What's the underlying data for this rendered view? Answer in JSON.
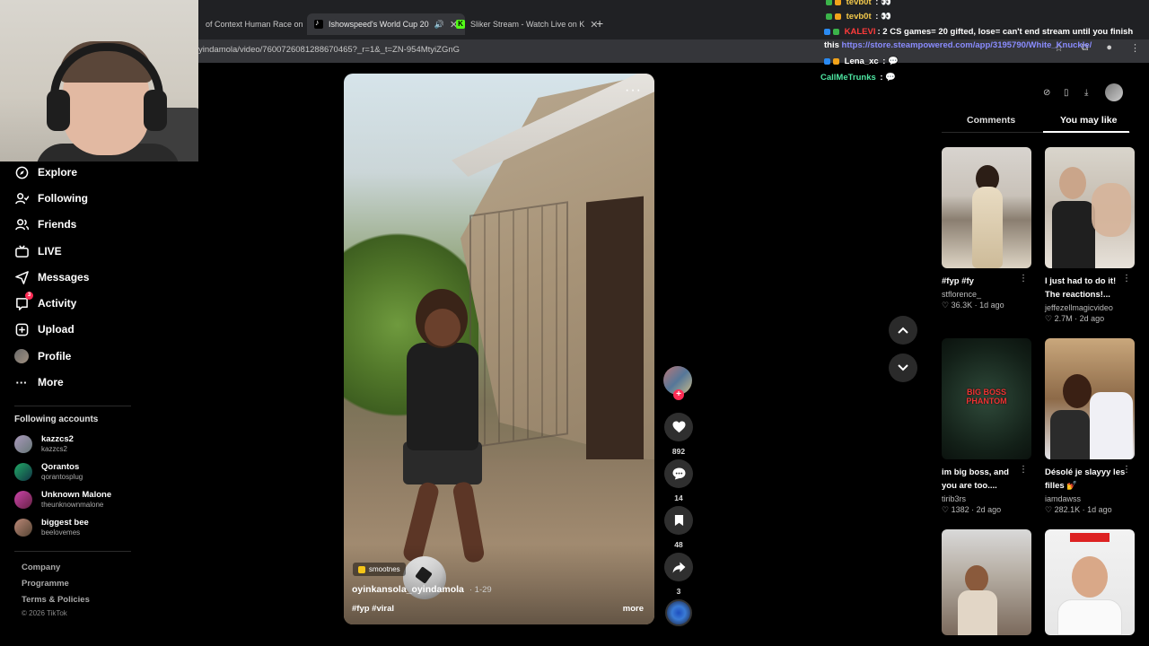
{
  "browser": {
    "tabs": [
      {
        "label": "of Context Human Race on"
      },
      {
        "label": "Ishowspeed's World Cup 20"
      },
      {
        "label": "Sliker Stream - Watch Live on K"
      }
    ],
    "url": "yindamola/video/7600726081288670465?_r=1&_t=ZN-954MtyiZGnG"
  },
  "chat": [
    {
      "user": "tevb0t",
      "text": "👀",
      "color": "#f2c94c"
    },
    {
      "user": "tevb0t",
      "text": "👀",
      "color": "#f2c94c"
    },
    {
      "user": "KALEVI",
      "text": "2 CS games= 20 gifted, lose= can't end stream until you finish",
      "color": "#ff3b3b"
    },
    {
      "user": "",
      "text": "this ",
      "link": "https://store.steampowered.com/app/3195790/White_Knuckle/",
      "color": "#ffffff"
    },
    {
      "user": "Lena_xc",
      "text": "💬",
      "color": "#ffffff"
    },
    {
      "user": "CallMeTrunks",
      "text": "💬",
      "color": "#4ee6a2"
    }
  ],
  "sidebar": {
    "items": [
      {
        "label": "Explore",
        "icon": "compass-icon"
      },
      {
        "label": "Following",
        "icon": "following-icon"
      },
      {
        "label": "Friends",
        "icon": "friends-icon"
      },
      {
        "label": "LIVE",
        "icon": "live-icon"
      },
      {
        "label": "Messages",
        "icon": "messages-icon"
      },
      {
        "label": "Activity",
        "icon": "activity-icon",
        "badge": "3"
      },
      {
        "label": "Upload",
        "icon": "upload-icon"
      },
      {
        "label": "Profile",
        "icon": "profile-avatar"
      },
      {
        "label": "More",
        "icon": "more-icon"
      }
    ],
    "following_title": "Following accounts",
    "following": [
      {
        "name": "kazzcs2",
        "handle": "kazzcs2"
      },
      {
        "name": "Qorantos",
        "handle": "qorantosplug"
      },
      {
        "name": "Unknown Malone",
        "handle": "theunknownmalone"
      },
      {
        "name": "biggest bee",
        "handle": "beelovemes"
      }
    ],
    "footer": [
      "Company",
      "Programme",
      "Terms & Policies"
    ],
    "copyright": "© 2026 TikTok"
  },
  "video": {
    "chip": "smootnes",
    "author": "oyinkansola_oyindamola",
    "date": "· 1-29",
    "hashtags": "#fyp #viral",
    "more": "more",
    "menu": "···"
  },
  "actions": {
    "likes": "892",
    "comments": "14",
    "saves": "48",
    "shares": "3"
  },
  "right_panel": {
    "tabs": [
      "Comments",
      "You may like"
    ],
    "active_tab": "You may like",
    "cards": [
      {
        "title": "#fyp #fy",
        "user": "stflorence_",
        "likes": "36.3K",
        "age": "1d ago"
      },
      {
        "title": "I just had to do it! The reactions!...",
        "user": "jeffezellmagicvideo",
        "likes": "2.7M",
        "age": "2d ago"
      },
      {
        "title": "im big boss, and you are too....",
        "user": "tirib3rs",
        "likes": "1382",
        "age": "2d ago"
      },
      {
        "title": "Désolé je slayyy les filles 💅",
        "user": "iamdawss",
        "likes": "282.1K",
        "age": "1d ago"
      },
      {
        "title": "",
        "user": "",
        "likes": "",
        "age": ""
      },
      {
        "title": "",
        "user": "",
        "likes": "",
        "age": ""
      }
    ],
    "thumb_text": "BIG BOSS PHANTOM"
  }
}
